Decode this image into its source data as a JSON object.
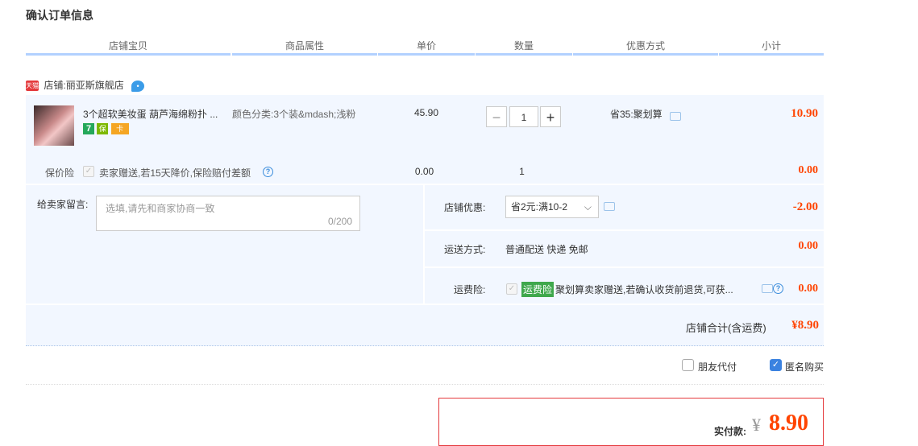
{
  "page_title": "确认订单信息",
  "columns": [
    "店铺宝贝",
    "商品属性",
    "单价",
    "数量",
    "优惠方式",
    "小计"
  ],
  "shop": {
    "badge": "天猫",
    "label": "店铺:",
    "name": "丽亚斯旗舰店"
  },
  "item": {
    "name": "3个超软美妆蛋 葫芦海绵粉扑 ...",
    "attr": "颜色分类:3个装&mdash;浅粉",
    "price": "45.90",
    "quantity": "1",
    "discount": "省35:聚划算",
    "subtotal": "10.90",
    "badges": [
      "7",
      "保",
      "卡"
    ],
    "qty_minus": "−",
    "qty_plus": "+"
  },
  "insurance": {
    "label": "保价险",
    "text": "卖家赠送,若15天降价,保险赔付差额",
    "price": "0.00",
    "quantity": "1",
    "subtotal": "0.00"
  },
  "message": {
    "label": "给卖家留言:",
    "placeholder": "选填,请先和商家协商一致",
    "counter": "0/200"
  },
  "shop_discount": {
    "label": "店铺优惠:",
    "selected": "省2元:满10-2",
    "amount": "-2.00"
  },
  "delivery": {
    "label": "运送方式:",
    "value": "普通配送 快递 免邮",
    "amount": "0.00"
  },
  "freight_insurance": {
    "label": "运费险:",
    "tag": "运费险",
    "text": "聚划算卖家赠送,若确认收货前退货,可获...",
    "amount": "0.00"
  },
  "shop_total": {
    "label": "店铺合计(含运费)",
    "amount": "¥8.90"
  },
  "options": {
    "friend_pay": "朋友代付",
    "anonymous": "匿名购买",
    "friend_pay_checked": false,
    "anonymous_checked": true
  },
  "payment": {
    "label": "实付款:",
    "currency": "¥",
    "amount": "8.90"
  },
  "colors": {
    "accent_red": "#f40",
    "header_line": "#b2d1ff",
    "panel_bg": "#f2f7ff",
    "checkbox_blue": "#3b82e0",
    "tag_green": "#3fa84c"
  }
}
